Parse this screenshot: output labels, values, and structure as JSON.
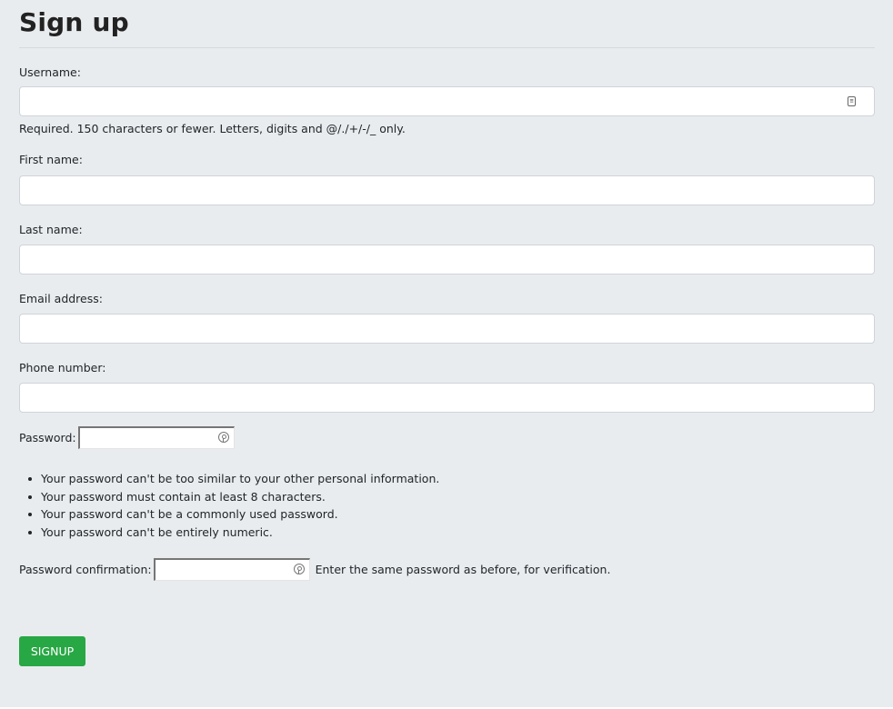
{
  "page": {
    "title": "Sign up"
  },
  "form": {
    "username": {
      "label": "Username:",
      "value": "",
      "help": "Required. 150 characters or fewer. Letters, digits and @/./+/-/_ only."
    },
    "first_name": {
      "label": "First name:",
      "value": ""
    },
    "last_name": {
      "label": "Last name:",
      "value": ""
    },
    "email": {
      "label": "Email address:",
      "value": ""
    },
    "phone": {
      "label": "Phone number:",
      "value": ""
    },
    "password": {
      "label": "Password:",
      "value": "",
      "rules": [
        "Your password can't be too similar to your other personal information.",
        "Your password must contain at least 8 characters.",
        "Your password can't be a commonly used password.",
        "Your password can't be entirely numeric."
      ]
    },
    "password_confirmation": {
      "label": "Password confirmation:",
      "value": "",
      "help": "Enter the same password as before, for verification."
    },
    "submit_label": "SIGNUP"
  },
  "colors": {
    "background": "#e9ecef",
    "button": "#28a745",
    "button_text": "#ffffff"
  },
  "icons": {
    "username_field": "contact-card-icon",
    "password_field": "key-icon"
  }
}
